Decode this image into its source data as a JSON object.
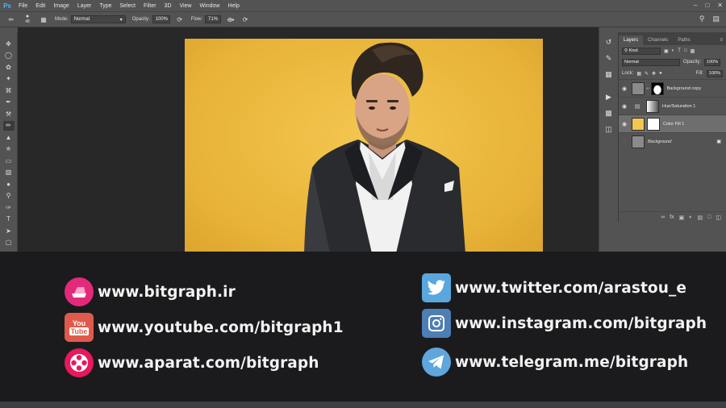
{
  "app": {
    "logo": "Ps",
    "menu": [
      "File",
      "Edit",
      "Image",
      "Layer",
      "Type",
      "Select",
      "Filter",
      "3D",
      "View",
      "Window",
      "Help"
    ]
  },
  "options_bar": {
    "brush_size": "48",
    "mode_label": "Mode:",
    "mode_value": "Normal",
    "opacity_label": "Opacity:",
    "opacity_value": "100%",
    "flow_label": "Flow:",
    "flow_value": "71%"
  },
  "tools": [
    "move-icon",
    "marquee-icon",
    "lasso-icon",
    "magic-wand-icon",
    "crop-icon",
    "eyedropper-icon",
    "healing-icon",
    "brush-icon",
    "stamp-icon",
    "history-brush-icon",
    "eraser-icon",
    "gradient-icon",
    "blur-icon",
    "dodge-icon",
    "pen-icon",
    "type-icon",
    "path-select-icon",
    "shape-icon"
  ],
  "layers_panel": {
    "tabs": [
      "Layers",
      "Channels",
      "Paths"
    ],
    "active_tab": "Layers",
    "filter_label": "Kind",
    "blend_mode": "Normal",
    "opacity_label": "Opacity:",
    "opacity_value": "100%",
    "lock_label": "Lock:",
    "fill_label": "Fill:",
    "fill_value": "100%",
    "layers": [
      {
        "name": "Background copy",
        "visible": true,
        "selected": false
      },
      {
        "name": "Hue/Saturation 1",
        "visible": true,
        "selected": false
      },
      {
        "name": "Color Fill 1",
        "visible": true,
        "selected": true,
        "color": "#f3c64f"
      },
      {
        "name": "Background",
        "visible": false,
        "selected": false,
        "locked": true
      }
    ]
  },
  "social_links": [
    {
      "text": "www.bitgraph.ir",
      "icon": "bitgraph-logo-icon",
      "color": "#e32a7a"
    },
    {
      "text": "www.youtube.com/bitgraph1",
      "icon": "youtube-icon",
      "color": "#e05a4c"
    },
    {
      "text": "www.aparat.com/bitgraph",
      "icon": "aparat-icon",
      "color": "#e8185c"
    },
    {
      "text": "www.twitter.com/arastou_e",
      "icon": "twitter-icon",
      "color": "#5aa7de"
    },
    {
      "text": "www.instagram.com/bitgraph",
      "icon": "instagram-icon",
      "color": "#4d7eb4"
    },
    {
      "text": "www.telegram.me/bitgraph",
      "icon": "telegram-icon",
      "color": "#5fa6dc"
    }
  ]
}
